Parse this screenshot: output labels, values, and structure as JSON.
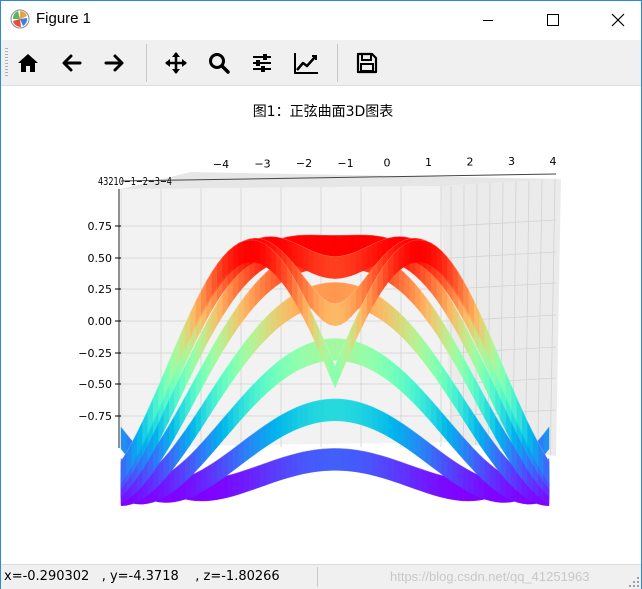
{
  "window": {
    "title": "Figure 1"
  },
  "toolbar": {
    "buttons": [
      {
        "icon": "home-icon",
        "tooltip": "Home"
      },
      {
        "icon": "back-arrow-icon",
        "tooltip": "Back"
      },
      {
        "icon": "forward-arrow-icon",
        "tooltip": "Forward"
      },
      {
        "icon": "pan-icon",
        "tooltip": "Pan"
      },
      {
        "icon": "zoom-icon",
        "tooltip": "Zoom"
      },
      {
        "icon": "subplots-icon",
        "tooltip": "Subplots"
      },
      {
        "icon": "customize-icon",
        "tooltip": "Customize"
      },
      {
        "icon": "save-icon",
        "tooltip": "Save"
      }
    ]
  },
  "plot": {
    "title": "图1：正弦曲面3D图表",
    "x_ticks": [
      "−4",
      "−3",
      "−2",
      "−1",
      "0",
      "1",
      "2",
      "3",
      "4"
    ],
    "z_ticks": [
      "0.75",
      "0.50",
      "0.25",
      "0.00",
      "−0.25",
      "−0.50",
      "−0.75"
    ],
    "y_ticks_cramped": "43210−1−2−3−4",
    "colormap": "rainbow"
  },
  "chart_data": {
    "type": "surface3d",
    "title": "图1：正弦曲面3D图表",
    "function": "z = sin(sqrt(x^2 + y^2))",
    "x_range": [
      -4,
      4
    ],
    "y_range": [
      -4,
      4
    ],
    "z_range": [
      -1,
      1
    ],
    "colormap": "rainbow",
    "grid": true
  },
  "status": {
    "coords": "x=-0.290302   , y=-4.3718    , z=-1.80266",
    "watermark": "https://blog.csdn.net/qq_41251963"
  }
}
